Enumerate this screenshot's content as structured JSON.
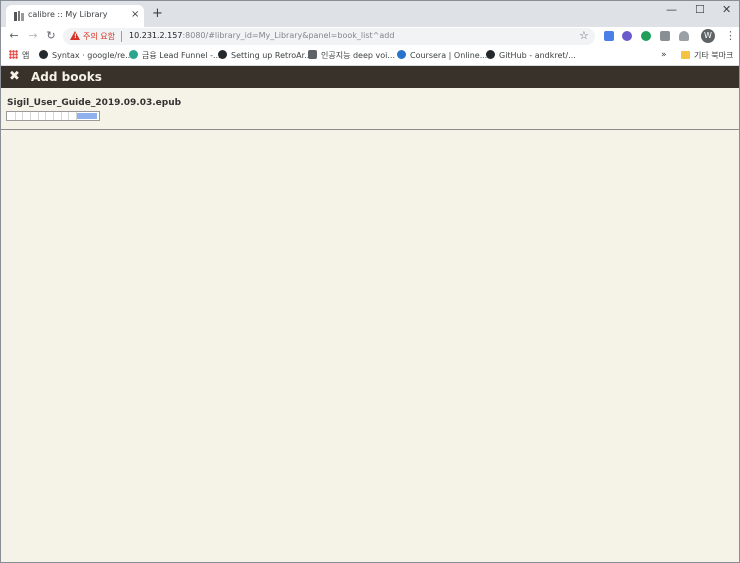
{
  "browser": {
    "tab": {
      "title": "calibre :: My Library",
      "close": "×"
    },
    "new_tab": "+",
    "window_controls": {
      "minimize": "—",
      "maximize": "☐",
      "close": "✕"
    },
    "nav": {
      "back": "←",
      "forward": "→",
      "reload": "↻"
    },
    "omnibox": {
      "warning_label": "주의 요함",
      "url_host": "10.231.2.157",
      "url_rest": ":8080/#library_id=My_Library&panel=book_list^add"
    },
    "profile_initial": "W",
    "menu": "⋮",
    "bookmarks": [
      {
        "label": "앱",
        "icon": "apps-grid-icon"
      },
      {
        "label": "Syntax · google/re...",
        "icon": "github-icon"
      },
      {
        "label": "금융 Lead Funnel -...",
        "icon": "globe-icon"
      },
      {
        "label": "Setting up RetroAr...",
        "icon": "github-icon"
      },
      {
        "label": "인공지능 deep voi...",
        "icon": "link-icon"
      },
      {
        "label": "Coursera | Online...",
        "icon": "coursera-icon"
      },
      {
        "label": "GitHub - andkret/...",
        "icon": "github-icon"
      }
    ],
    "bookmarks_more": "»",
    "other_bookmarks": "기타 북마크"
  },
  "page": {
    "header": {
      "close": "✖",
      "title": "Add books"
    },
    "upload": {
      "filename": "Sigil_User_Guide_2019.09.03.epub",
      "progress": 0.22
    }
  },
  "colors": {
    "header_bg": "#39322a",
    "page_bg": "#f5f2e7",
    "progress_fill": "#8fb2ef",
    "warning": "#d93025"
  }
}
